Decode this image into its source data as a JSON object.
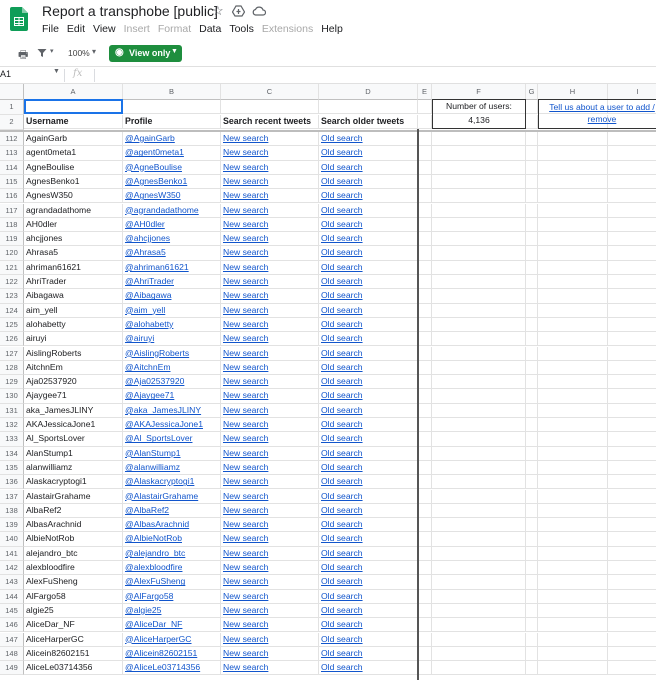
{
  "app": {
    "title": "Report a transphobe [public]",
    "star_icon": "star-icon",
    "move_icon": "move-to-drive-icon",
    "cloud_icon": "cloud-status-icon"
  },
  "menu": [
    {
      "label": "File",
      "enabled": true
    },
    {
      "label": "Edit",
      "enabled": true
    },
    {
      "label": "View",
      "enabled": true
    },
    {
      "label": "Insert",
      "enabled": false
    },
    {
      "label": "Format",
      "enabled": false
    },
    {
      "label": "Data",
      "enabled": true
    },
    {
      "label": "Tools",
      "enabled": true
    },
    {
      "label": "Extensions",
      "enabled": false
    },
    {
      "label": "Help",
      "enabled": true
    }
  ],
  "toolbar": {
    "zoom": "100%",
    "view_only_label": "View only",
    "accent_color": "#1e8e3e"
  },
  "formula_bar": {
    "cell_ref": "A1",
    "fx": "fx"
  },
  "columns": [
    "A",
    "B",
    "C",
    "D",
    "E",
    "F",
    "G",
    "H",
    "I"
  ],
  "header_row": {
    "username": "Username",
    "profile": "Profile",
    "recent": "Search recent tweets",
    "older": "Search older tweets"
  },
  "stats": {
    "users_label": "Number of users:",
    "users_count": "4,136",
    "report_link": "Tell us about a user to add / remove"
  },
  "link_labels": {
    "new_search": "New search",
    "old_search": "Old search"
  },
  "rows": [
    {
      "n": "112",
      "user": "AgainGarb",
      "profile": "@AgainGarb"
    },
    {
      "n": "113",
      "user": "agent0meta1",
      "profile": "@agent0meta1"
    },
    {
      "n": "114",
      "user": "AgneBoulise",
      "profile": "@AgneBoulise"
    },
    {
      "n": "115",
      "user": "AgnesBenko1",
      "profile": "@AgnesBenko1"
    },
    {
      "n": "116",
      "user": "AgnesW350",
      "profile": "@AgnesW350"
    },
    {
      "n": "117",
      "user": "agrandadathome",
      "profile": "@agrandadathome"
    },
    {
      "n": "118",
      "user": "AH0dler",
      "profile": "@AH0dler"
    },
    {
      "n": "119",
      "user": "ahcjjones",
      "profile": "@ahcjjones"
    },
    {
      "n": "120",
      "user": "Ahrasa5",
      "profile": "@Ahrasa5"
    },
    {
      "n": "121",
      "user": "ahriman61621",
      "profile": "@ahriman61621"
    },
    {
      "n": "122",
      "user": "AhriTrader",
      "profile": "@AhriTrader"
    },
    {
      "n": "123",
      "user": "Aibagawa",
      "profile": "@Aibagawa"
    },
    {
      "n": "124",
      "user": "aim_yell",
      "profile": "@aim_yell"
    },
    {
      "n": "125",
      "user": "alohabetty",
      "profile": "@alohabetty"
    },
    {
      "n": "126",
      "user": "airuyi",
      "profile": "@airuyi"
    },
    {
      "n": "127",
      "user": "AislingRoberts",
      "profile": "@AislingRoberts"
    },
    {
      "n": "128",
      "user": "AitchnEm",
      "profile": "@AitchnEm"
    },
    {
      "n": "129",
      "user": "Aja02537920",
      "profile": "@Aja02537920"
    },
    {
      "n": "130",
      "user": "Ajaygee71",
      "profile": "@Ajaygee71"
    },
    {
      "n": "131",
      "user": "aka_JamesJLINY",
      "profile": "@aka_JamesJLINY"
    },
    {
      "n": "132",
      "user": "AKAJessicaJone1",
      "profile": "@AKAJessicaJone1"
    },
    {
      "n": "133",
      "user": "Al_SportsLover",
      "profile": "@Al_SportsLover"
    },
    {
      "n": "134",
      "user": "AlanStump1",
      "profile": "@AlanStump1"
    },
    {
      "n": "135",
      "user": "alanwilliamz",
      "profile": "@alanwilliamz"
    },
    {
      "n": "136",
      "user": "Alaskacryptogi1",
      "profile": "@Alaskacryptogi1"
    },
    {
      "n": "137",
      "user": "AlastairGrahame",
      "profile": "@AlastairGrahame"
    },
    {
      "n": "138",
      "user": "AlbaRef2",
      "profile": "@AlbaRef2"
    },
    {
      "n": "139",
      "user": "AlbasArachnid",
      "profile": "@AlbasArachnid"
    },
    {
      "n": "140",
      "user": "AlbieNotRob",
      "profile": "@AlbieNotRob"
    },
    {
      "n": "141",
      "user": "alejandro_btc",
      "profile": "@alejandro_btc"
    },
    {
      "n": "142",
      "user": "alexbloodfire",
      "profile": "@alexbloodfire"
    },
    {
      "n": "143",
      "user": "AlexFuSheng",
      "profile": "@AlexFuSheng"
    },
    {
      "n": "144",
      "user": "AlFargo58",
      "profile": "@AlFargo58"
    },
    {
      "n": "145",
      "user": "algie25",
      "profile": "@algie25"
    },
    {
      "n": "146",
      "user": "AliceDar_NF",
      "profile": "@AliceDar_NF"
    },
    {
      "n": "147",
      "user": "AliceHarperGC",
      "profile": "@AliceHarperGC"
    },
    {
      "n": "148",
      "user": "Alicein82602151",
      "profile": "@Alicein82602151"
    },
    {
      "n": "149",
      "user": "AliceLe03714356",
      "profile": "@AliceLe03714356"
    }
  ]
}
